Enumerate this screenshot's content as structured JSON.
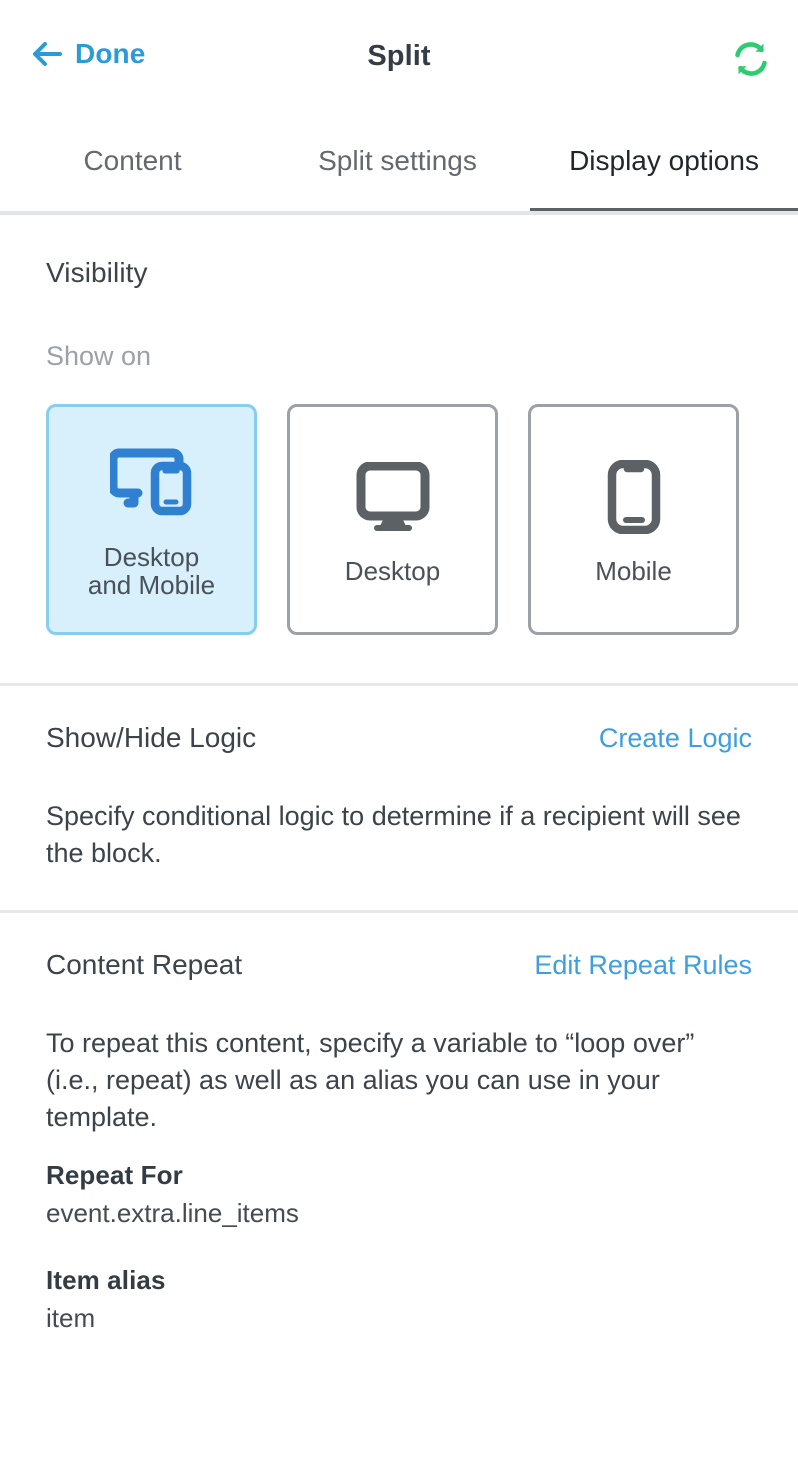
{
  "header": {
    "back_label": "Done",
    "title": "Split",
    "back_icon": "arrow-left-icon",
    "sync_icon": "sync-refresh-icon"
  },
  "tabs": [
    {
      "label": "Content",
      "active": false
    },
    {
      "label": "Split settings",
      "active": false
    },
    {
      "label": "Display options",
      "active": true
    }
  ],
  "visibility": {
    "title": "Visibility",
    "show_on_label": "Show on",
    "options": [
      {
        "label": "Desktop\nand Mobile",
        "icon": "desktop-and-mobile-icon",
        "selected": true
      },
      {
        "label": "Desktop",
        "icon": "desktop-monitor-icon",
        "selected": false
      },
      {
        "label": "Mobile",
        "icon": "mobile-phone-icon",
        "selected": false
      }
    ]
  },
  "show_hide_logic": {
    "title": "Show/Hide Logic",
    "action_label": "Create Logic",
    "description": "Specify conditional logic to determine if a recipient will see the block."
  },
  "content_repeat": {
    "title": "Content Repeat",
    "action_label": "Edit Repeat Rules",
    "description": "To repeat this content, specify a variable to “loop over” (i.e., repeat) as well as an alias you can use in your template.",
    "fields": [
      {
        "label": "Repeat For",
        "value": "event.extra.line_items"
      },
      {
        "label": "Item alias",
        "value": "item"
      }
    ]
  },
  "colors": {
    "link_blue": "#3d9fe0",
    "done_blue": "#2a9bd8",
    "sync_green": "#2ecc71",
    "selected_card_bg": "#d8effc",
    "selected_card_border": "#86cdef",
    "selected_icon_blue": "#2f80d0",
    "icon_gray": "#5c6166",
    "active_tab_underline": "#5c6166",
    "divider": "#e6e9ec"
  }
}
